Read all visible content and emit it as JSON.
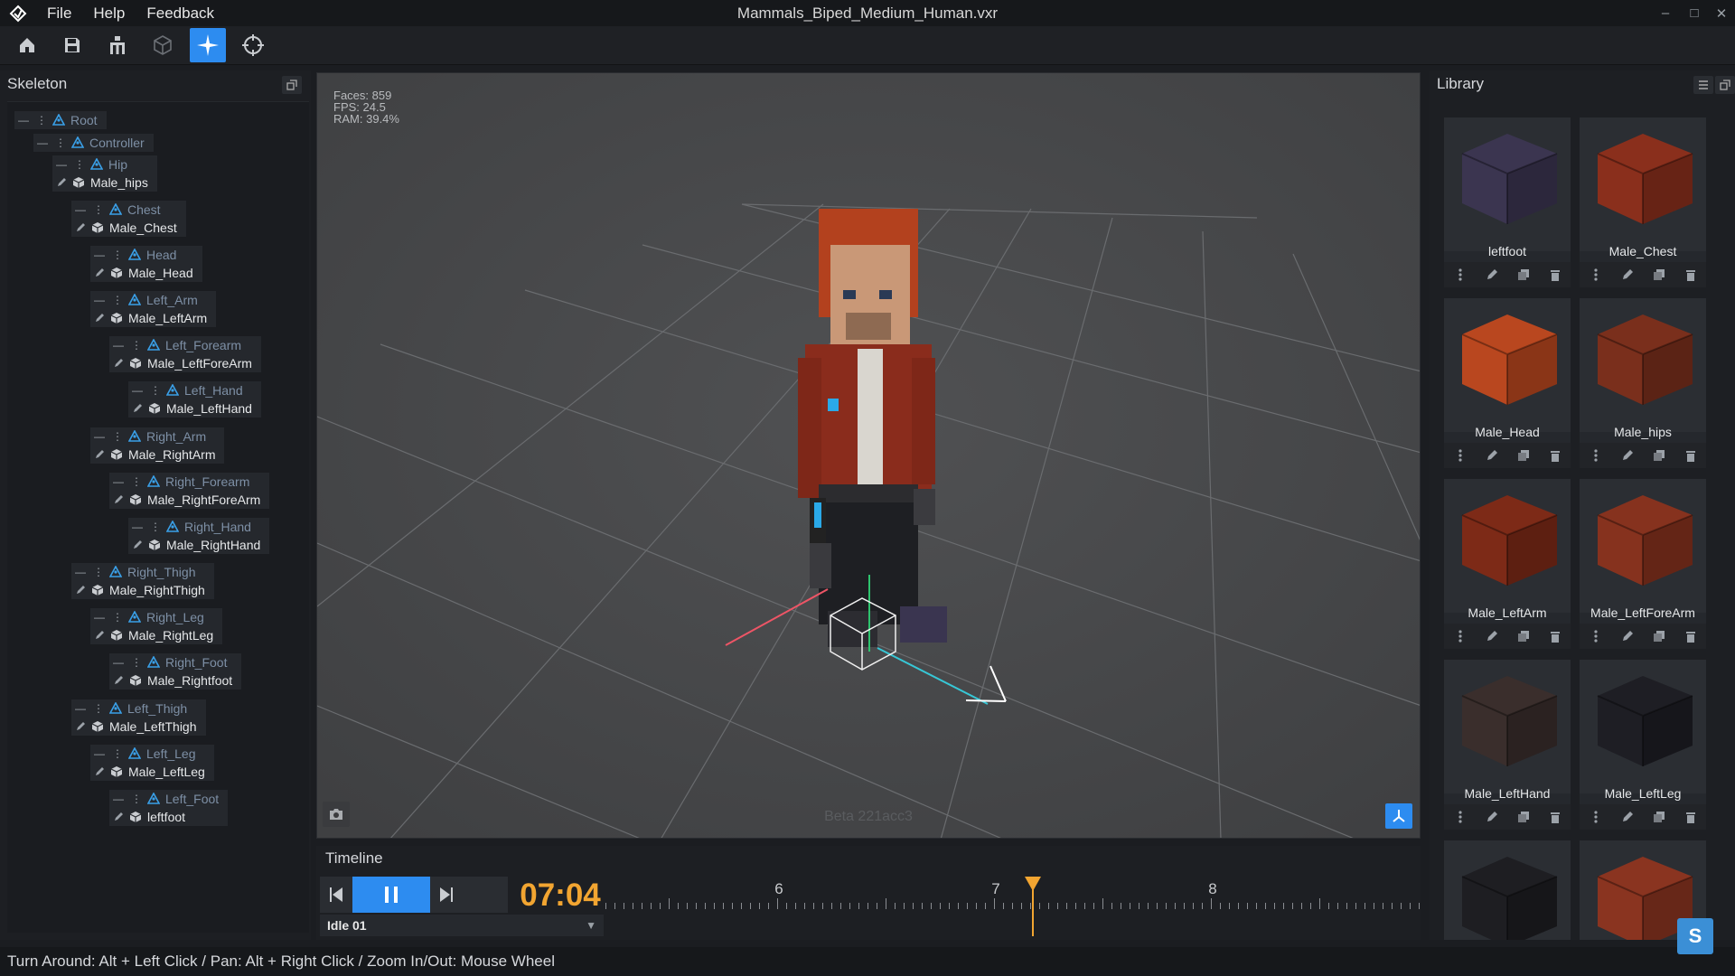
{
  "window": {
    "title": "Mammals_Biped_Medium_Human.vxr",
    "minimize": "–",
    "maximize": "□",
    "close": "✕"
  },
  "menu": [
    {
      "label": "File"
    },
    {
      "label": "Help"
    },
    {
      "label": "Feedback"
    }
  ],
  "toolbar": {
    "icons": [
      "home-icon",
      "save-icon",
      "skeleton-icon",
      "cube-icon",
      "sparkle-icon",
      "target-icon"
    ],
    "active": "sparkle-icon",
    "accent": "#2d8cf0"
  },
  "skeleton": {
    "title": "Skeleton",
    "bones": [
      {
        "joint": "Root",
        "mesh": ""
      },
      {
        "joint": "Controller",
        "mesh": ""
      },
      {
        "joint": "Hip",
        "mesh": "Male_hips"
      },
      {
        "joint": "Chest",
        "mesh": "Male_Chest"
      },
      {
        "joint": "Head",
        "mesh": "Male_Head"
      },
      {
        "joint": "Left_Arm",
        "mesh": "Male_LeftArm"
      },
      {
        "joint": "Left_Forearm",
        "mesh": "Male_LeftForeArm"
      },
      {
        "joint": "Left_Hand",
        "mesh": "Male_LeftHand"
      },
      {
        "joint": "Right_Arm",
        "mesh": "Male_RightArm"
      },
      {
        "joint": "Right_Forearm",
        "mesh": "Male_RightForeArm"
      },
      {
        "joint": "Right_Hand",
        "mesh": "Male_RightHand"
      },
      {
        "joint": "Right_Thigh",
        "mesh": "Male_RightThigh"
      },
      {
        "joint": "Right_Leg",
        "mesh": "Male_RightLeg"
      },
      {
        "joint": "Right_Foot",
        "mesh": "Male_Rightfoot"
      },
      {
        "joint": "Left_Thigh",
        "mesh": "Male_LeftThigh"
      },
      {
        "joint": "Left_Leg",
        "mesh": "Male_LeftLeg"
      },
      {
        "joint": "Left_Foot",
        "mesh": "leftfoot"
      }
    ]
  },
  "viewport": {
    "stats": {
      "faces": "Faces: 859",
      "fps": "FPS: 24.5",
      "ram": "RAM: 39.4%"
    },
    "version": "Beta 221acc3"
  },
  "timeline": {
    "title": "Timeline",
    "time": "07:04",
    "animation": "Idle 01",
    "ticks": [
      "6",
      "7",
      "8"
    ],
    "playhead_seconds": 7.17
  },
  "library": {
    "title": "Library",
    "items": [
      {
        "label": "leftfoot",
        "color": "#3b3550"
      },
      {
        "label": "Male_Chest",
        "color": "#8a2f1c"
      },
      {
        "label": "Male_Head",
        "color": "#b9471f"
      },
      {
        "label": "Male_hips",
        "color": "#7a2f1c"
      },
      {
        "label": "Male_LeftArm",
        "color": "#7d2a17"
      },
      {
        "label": "Male_LeftForeArm",
        "color": "#86321e"
      },
      {
        "label": "Male_LeftHand",
        "color": "#3a2e2c"
      },
      {
        "label": "Male_LeftLeg",
        "color": "#1e1e24"
      },
      {
        "label": "",
        "color": "#1e1e22"
      },
      {
        "label": "",
        "color": "#8a3420"
      }
    ]
  },
  "status": {
    "hint": "Turn Around: Alt + Left Click / Pan: Alt + Right Click / Zoom In/Out: Mouse Wheel",
    "subscribe": "S"
  }
}
